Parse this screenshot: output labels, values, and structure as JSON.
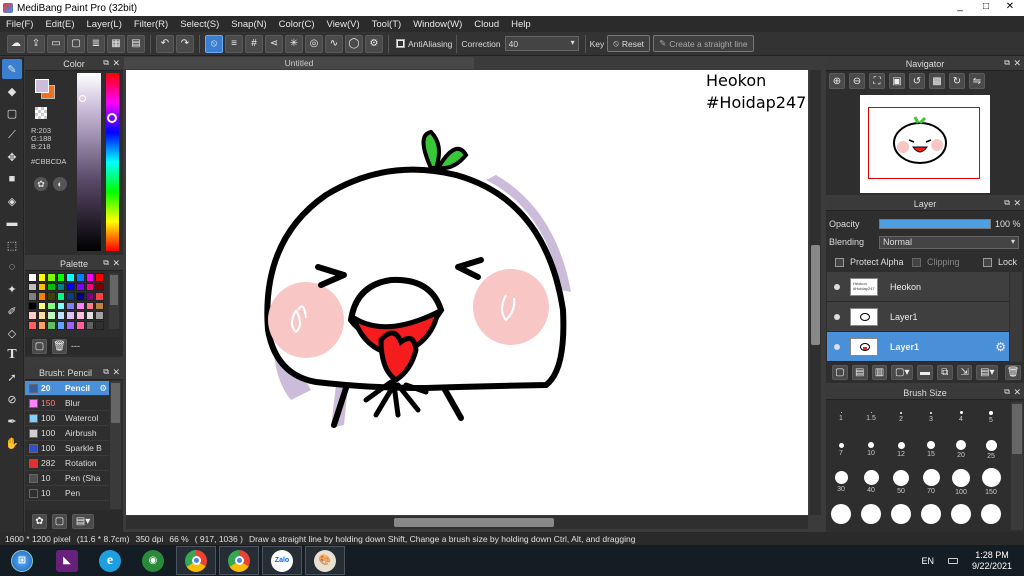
{
  "window": {
    "title": "MediBang Paint Pro (32bit)",
    "controls": [
      "_",
      "□",
      "✕"
    ]
  },
  "menu": [
    "File(F)",
    "Edit(E)",
    "Layer(L)",
    "Filter(R)",
    "Select(S)",
    "Snap(N)",
    "Color(C)",
    "View(V)",
    "Tool(T)",
    "Window(W)",
    "Cloud",
    "Help"
  ],
  "toolbar": {
    "antialiasing_label": "AntiAliasing",
    "antialiasing_checked": true,
    "correction_label": "Correction",
    "correction_value": "40",
    "key_label": "Key",
    "reset_label": "Reset",
    "straight_line_label": "Create a straight line"
  },
  "document": {
    "tab_title": "Untitled",
    "watermark_line1": "Heokon",
    "watermark_line2": "#Hoidap247"
  },
  "color_panel": {
    "title": "Color",
    "r": "R:203",
    "g": "G:188",
    "b": "B:218",
    "hex": "#CBBCDA",
    "primary_color": "#CBBCDA",
    "secondary_color": "#F07020"
  },
  "palette_panel": {
    "title": "Palette",
    "name": "---",
    "swatches": [
      "#ffffff",
      "#ffff00",
      "#80ff00",
      "#00ff00",
      "#00ffff",
      "#0080ff",
      "#ff00ff",
      "#ff0000",
      "#c0c0c0",
      "#ffc000",
      "#00c000",
      "#008080",
      "#0000ff",
      "#8000ff",
      "#ff0080",
      "#800000",
      "#808080",
      "#ff8000",
      "#404000",
      "#00ff80",
      "#004080",
      "#000080",
      "#800080",
      "#ff4040",
      "#000000",
      "#ffff80",
      "#80ff80",
      "#80ffff",
      "#8080ff",
      "#ff80ff",
      "#ff8080",
      "#c08040",
      "#ffcccc",
      "#ffe0a0",
      "#c0ffc0",
      "#c0e0ff",
      "#e0c0ff",
      "#ffc0e0",
      "#e0e0e0",
      "#a0a0a0",
      "#ff6060",
      "#ffa060",
      "#60c060",
      "#60a0ff",
      "#a060ff",
      "#ff60a0",
      "#606060",
      "#303030"
    ]
  },
  "brush_panel": {
    "title": "Brush: Pencil",
    "brushes": [
      {
        "size": "20",
        "name": "Pencil",
        "color": "#3a5fa0",
        "active": true
      },
      {
        "size": "150",
        "name": "Blur",
        "color": "#ff80ff",
        "active": false
      },
      {
        "size": "100",
        "name": "Watercol",
        "color": "#80d0ff",
        "active": false
      },
      {
        "size": "100",
        "name": "Airbrush",
        "color": "#d0d0d0",
        "active": false
      },
      {
        "size": "100",
        "name": "Sparkle B",
        "color": "#3050d0",
        "active": false
      },
      {
        "size": "282",
        "name": "Rotation",
        "color": "#e03030",
        "active": false
      },
      {
        "size": "10",
        "name": "Pen (Sha",
        "color": "#505050",
        "active": false
      },
      {
        "size": "10",
        "name": "Pen",
        "color": "#303030",
        "active": false
      }
    ]
  },
  "navigator": {
    "title": "Navigator"
  },
  "layer_panel": {
    "title": "Layer",
    "opacity_label": "Opacity",
    "opacity_value": "100 %",
    "opacity_fraction": 1.0,
    "blending_label": "Blending",
    "blending_value": "Normal",
    "protect_alpha_label": "Protect Alpha",
    "clipping_label": "Clipping",
    "lock_label": "Lock",
    "layers": [
      {
        "name": "Heokon",
        "thumb_text": "Heokon #Hoidap247",
        "active": false
      },
      {
        "name": "Layer1",
        "thumb_text": "",
        "active": false
      },
      {
        "name": "Layer1",
        "thumb_text": "",
        "active": true
      }
    ]
  },
  "brush_size_panel": {
    "title": "Brush Size",
    "sizes": [
      "1",
      "1.5",
      "2",
      "3",
      "4",
      "5",
      "7",
      "10",
      "12",
      "15",
      "20",
      "25",
      "30",
      "40",
      "50",
      "70",
      "100",
      "150"
    ]
  },
  "status": {
    "dimensions": "1600 * 1200 pixel",
    "physical": "(11.6 * 8.7cm)",
    "dpi": "350 dpi",
    "zoom": "66 %",
    "coords": "( 917, 1036 )",
    "hint": "Draw a straight line by holding down Shift, Change a brush size by holding down Ctrl, Alt, and dragging"
  },
  "taskbar": {
    "language": "EN",
    "time": "1:28 PM",
    "date": "9/22/2021",
    "apps": [
      {
        "name": "start",
        "label": ""
      },
      {
        "name": "visual-studio",
        "label": ""
      },
      {
        "name": "internet-explorer",
        "label": "e"
      },
      {
        "name": "game-app",
        "label": ""
      },
      {
        "name": "chrome",
        "label": ""
      },
      {
        "name": "chrome-profile",
        "label": ""
      },
      {
        "name": "zalo",
        "label": "Zalo"
      },
      {
        "name": "medibang",
        "label": ""
      }
    ]
  }
}
